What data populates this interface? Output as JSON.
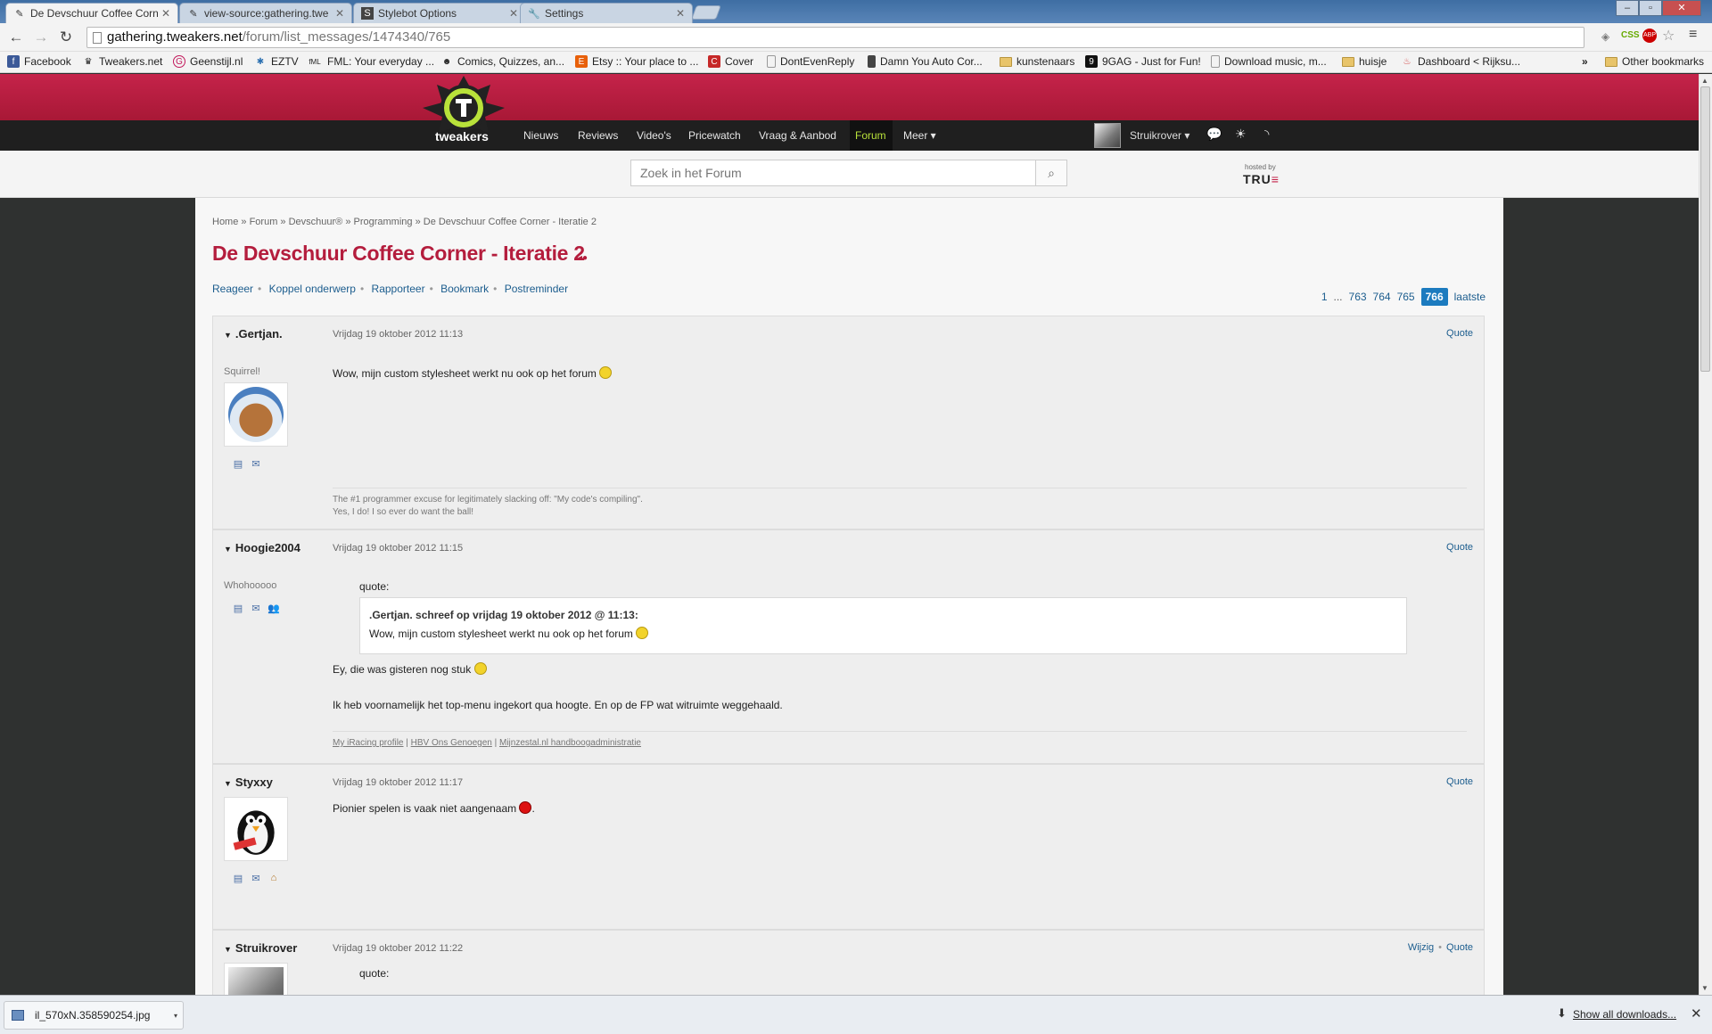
{
  "browser": {
    "tabs": [
      {
        "label": "De Devschuur Coffee Corn",
        "icon": "tweakers-favicon",
        "active": true
      },
      {
        "label": "view-source:gathering.twe",
        "icon": "document-favicon",
        "active": false
      },
      {
        "label": "Stylebot Options",
        "icon": "stylebot-favicon",
        "active": false
      },
      {
        "label": "Settings",
        "icon": "wrench-favicon",
        "active": false
      }
    ],
    "url_host": "gathering.tweakers.net",
    "url_path": "/forum/list_messages/1474340/765",
    "extension_css": "CSS",
    "extension_abp": "ABP",
    "bookmarks": [
      {
        "label": "Facebook",
        "icon": "facebook-icon",
        "color": "#3b5998"
      },
      {
        "label": "Tweakers.net",
        "icon": "tweakers-icon",
        "color": "#222222"
      },
      {
        "label": "Geenstijl.nl",
        "icon": "geenstijl-icon",
        "color": "#c2185b"
      },
      {
        "label": "EZTV",
        "icon": "eztv-icon",
        "color": "#2a6fb0"
      },
      {
        "label": "FML: Your everyday ...",
        "icon": "fml-icon",
        "color": "#222222"
      },
      {
        "label": "Comics, Quizzes, an...",
        "icon": "comics-icon",
        "color": "#222222"
      },
      {
        "label": "Etsy :: Your place to ...",
        "icon": "etsy-icon",
        "color": "#e8600a"
      },
      {
        "label": "Cover",
        "icon": "cover-icon",
        "color": "#c62828"
      },
      {
        "label": "DontEvenReply",
        "icon": "page-icon",
        "color": "#ffffff"
      },
      {
        "label": "Damn You Auto Cor...",
        "icon": "phone-icon",
        "color": "#444444"
      },
      {
        "label": "kunstenaars",
        "icon": "folder-icon",
        "color": "#e8c46a"
      },
      {
        "label": "9GAG - Just for Fun!",
        "icon": "9gag-icon",
        "color": "#111111"
      },
      {
        "label": "Download music, m...",
        "icon": "page-icon",
        "color": "#ffffff"
      },
      {
        "label": "huisje",
        "icon": "folder-icon",
        "color": "#e8c46a"
      },
      {
        "label": "Dashboard < Rijksu...",
        "icon": "dashboard-icon",
        "color": "#d04040"
      }
    ],
    "bookmarks_overflow": "»",
    "other_bookmarks": "Other bookmarks"
  },
  "site": {
    "logo_text": "tweakers",
    "nav": [
      "Nieuws",
      "Reviews",
      "Video's",
      "Pricewatch",
      "Vraag & Aanbod",
      "Forum",
      "Meer ▾"
    ],
    "username": "Struikrover ▾",
    "search_placeholder": "Zoek in het Forum",
    "hosted_by": "hosted by",
    "hosted_logo": "TRU",
    "hosted_logo_mark": "≡",
    "accent_color": "#b41d3d",
    "active_nav_color": "#b9e23a"
  },
  "topic": {
    "breadcrumb": "Home » Forum » Devschuur® » Programming » De Devschuur Coffee Corner - Iteratie 2",
    "title": "De Devschuur Coffee Corner - Iteratie 2",
    "title_icon": "◂●",
    "actions": [
      "Reageer",
      "Koppel onderwerp",
      "Rapporteer",
      "Bookmark",
      "Postreminder"
    ],
    "pagination": {
      "first": "1",
      "dots": "...",
      "pages": [
        "763",
        "764",
        "765"
      ],
      "current": "766",
      "last": "laatste"
    }
  },
  "posts": [
    {
      "author": ".Gertjan.",
      "date": "Vrijdag 19 oktober 2012 11:13",
      "actions": [
        "Quote"
      ],
      "usertitle": "Squirrel!",
      "body": "Wow, mijn custom stylesheet werkt nu ook op het forum",
      "signature_line1": "The #1 programmer excuse for legitimately slacking off: \"My code's compiling\".",
      "signature_line2": "Yes, I do! I so ever do want the ball!"
    },
    {
      "author": "Hoogie2004",
      "date": "Vrijdag 19 oktober 2012 11:15",
      "actions": [
        "Quote"
      ],
      "usertitle": "Whohooooo",
      "quote_label": "quote:",
      "quote_header": ".Gertjan. schreef op vrijdag 19 oktober 2012 @ 11:13:",
      "quote_text": "Wow, mijn custom stylesheet werkt nu ook op het forum",
      "body1": "Ey, die was gisteren nog stuk",
      "body2": "Ik heb voornamelijk het top-menu ingekort qua hoogte. En op de FP wat witruimte weggehaald.",
      "signature_links": [
        "My iRacing profile",
        "HBV Ons Genoegen",
        "Mijnzestal.nl handboogadministratie"
      ],
      "signature_sep": "|"
    },
    {
      "author": "Styxxy",
      "date": "Vrijdag 19 oktober 2012 11:17",
      "actions": [
        "Quote"
      ],
      "body": "Pionier spelen is vaak niet aangenaam",
      "body_end": "."
    },
    {
      "author": "Struikrover",
      "date": "Vrijdag 19 oktober 2012 11:22",
      "actions": [
        "Wijzig",
        "Quote"
      ],
      "quote_label": "quote:"
    }
  ],
  "downloads": {
    "file": "il_570xN.358590254.jpg",
    "show_all": "Show all downloads..."
  }
}
